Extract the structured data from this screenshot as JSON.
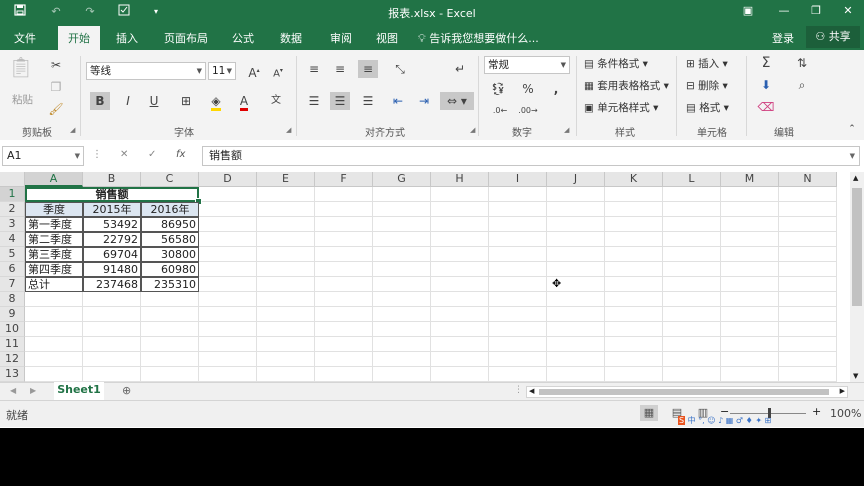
{
  "window": {
    "title": "报表.xlsx - Excel"
  },
  "quick_access": {
    "save_icon": "save-icon",
    "undo_icon": "undo-icon",
    "redo_icon": "redo-icon",
    "form_icon": "form-icon",
    "customize_icon": "customize-icon"
  },
  "window_controls": {
    "ribbon_display": "▣",
    "minimize": "—",
    "restore": "❐",
    "close": "✕"
  },
  "tabs": [
    {
      "label": "文件",
      "active": false
    },
    {
      "label": "开始",
      "active": true
    },
    {
      "label": "插入",
      "active": false
    },
    {
      "label": "页面布局",
      "active": false
    },
    {
      "label": "公式",
      "active": false
    },
    {
      "label": "数据",
      "active": false
    },
    {
      "label": "审阅",
      "active": false
    },
    {
      "label": "视图",
      "active": false
    }
  ],
  "tell_me": "告诉我您想要做什么...",
  "login": "登录",
  "share": "共享",
  "ribbon": {
    "clipboard": {
      "label": "剪贴板",
      "paste": "粘贴"
    },
    "font": {
      "label": "字体",
      "name": "等线",
      "size": "11",
      "bold": "B",
      "italic": "I",
      "underline": "U"
    },
    "alignment": {
      "label": "对齐方式"
    },
    "number": {
      "label": "数字",
      "format": "常规",
      "percent": "%",
      "comma": ","
    },
    "styles": {
      "label": "样式",
      "conditional": "条件格式",
      "table": "套用表格格式",
      "cell_styles": "单元格样式"
    },
    "cells": {
      "label": "单元格",
      "insert": "插入",
      "delete": "删除",
      "format": "格式"
    },
    "editing": {
      "label": "编辑"
    }
  },
  "formula_bar": {
    "name_box": "A1",
    "fx": "fx",
    "value": "销售额"
  },
  "columns": [
    "A",
    "B",
    "C",
    "D",
    "E",
    "F",
    "G",
    "H",
    "I",
    "J",
    "K",
    "L",
    "M",
    "N"
  ],
  "rows": [
    "1",
    "2",
    "3",
    "4",
    "5",
    "6",
    "7",
    "8",
    "9",
    "10",
    "11",
    "12",
    "13"
  ],
  "table": {
    "title": "销售额",
    "headers": [
      "季度",
      "2015年",
      "2016年"
    ],
    "rows": [
      [
        "第一季度",
        "53492",
        "86950"
      ],
      [
        "第二季度",
        "22792",
        "56580"
      ],
      [
        "第三季度",
        "69704",
        "30800"
      ],
      [
        "第四季度",
        "91480",
        "60980"
      ],
      [
        "总计",
        "237468",
        "235310"
      ]
    ]
  },
  "sheets": [
    {
      "name": "Sheet1",
      "active": true
    }
  ],
  "status": {
    "text": "就绪",
    "zoom": "100%"
  },
  "ime_toolbar": {
    "logo": "S",
    "text": "中 °, ☺ ♪ ▦ ♂ ♦ ✦ ⊞"
  }
}
